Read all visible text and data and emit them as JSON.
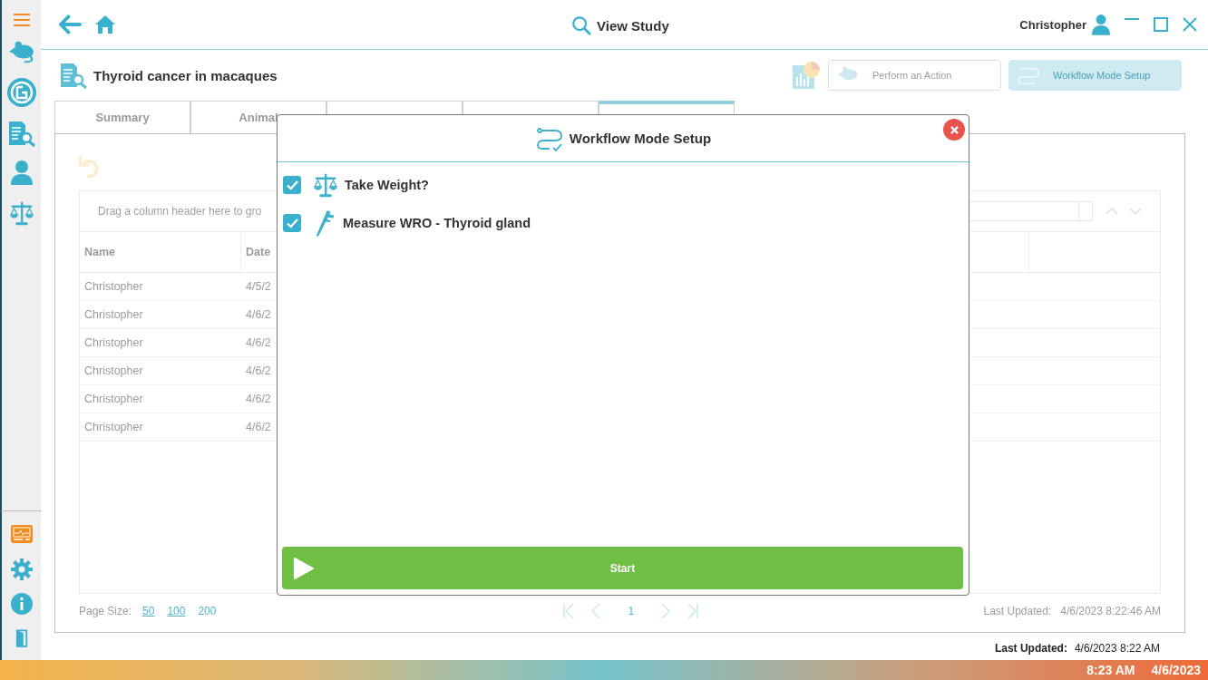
{
  "title_bar": {
    "title": "View Study",
    "user": "Christopher"
  },
  "study": {
    "title": "Thyroid cancer in macaques"
  },
  "actions": {
    "perform": "Perform an Action",
    "workflow": "Workflow Mode Setup"
  },
  "tabs": [
    {
      "label": "Summary",
      "selected": false
    },
    {
      "label": "Animal",
      "selected": false
    },
    {
      "selected": false
    },
    {
      "selected": false
    },
    {
      "selected": true
    }
  ],
  "grid": {
    "group_hint": "Drag a column header here to gro",
    "columns": [
      "Name",
      "Date"
    ],
    "rows": [
      {
        "name": "Christopher",
        "date": "4/5/2"
      },
      {
        "name": "Christopher",
        "date": "4/6/2"
      },
      {
        "name": "Christopher",
        "date": "4/6/2"
      },
      {
        "name": "Christopher",
        "date": "4/6/2"
      },
      {
        "name": "Christopher",
        "date": "4/6/2"
      },
      {
        "name": "Christopher",
        "date": "4/6/2"
      }
    ],
    "page_size_label": "Page Size:",
    "page_sizes": [
      {
        "label": "50",
        "selected": false
      },
      {
        "label": "100",
        "selected": false
      },
      {
        "label": "200",
        "selected": true
      }
    ],
    "page": "1",
    "last_updated_label": "Last Updated:",
    "last_updated": "4/6/2023 8:22:46 AM"
  },
  "status": {
    "label": "Last Updated:",
    "value": "4/6/2023 8:22 AM"
  },
  "taskbar": {
    "time": "8:23 AM",
    "date": "4/6/2023"
  },
  "dialog": {
    "title": "Workflow Mode Setup",
    "steps": [
      {
        "kind": "weight",
        "label": "Take Weight?",
        "checked": true
      },
      {
        "kind": "measurement",
        "label": "Measure WRO - Thyroid gland",
        "checked": true
      }
    ],
    "start": "Start"
  }
}
